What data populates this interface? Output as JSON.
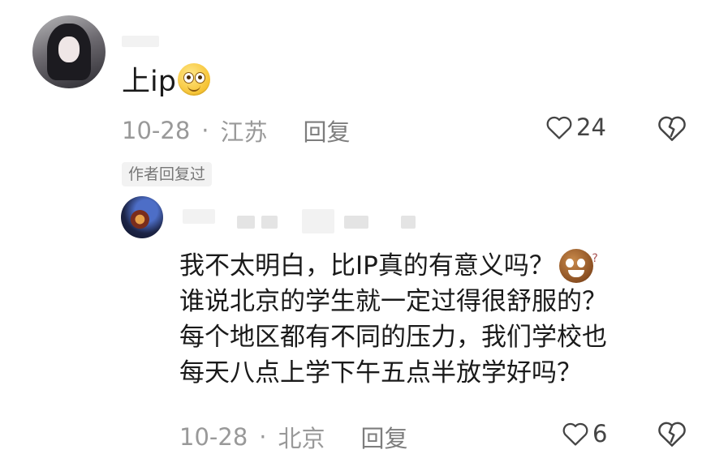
{
  "comment": {
    "text": "上ip",
    "emoji": "smiling-face-emoji",
    "date": "10-28",
    "location": "江苏",
    "reply_label": "回复",
    "likes": "24",
    "badge": "作者回复过"
  },
  "reply": {
    "lines": [
      "我不太明白，比IP真的有意义吗？",
      "谁说北京的学生就一定过得很舒服的？",
      "每个地区都有不同的压力，我们学校也",
      "每天八点上学下午五点半放学好吗？"
    ],
    "emoji": "cookie-face-emoji",
    "date": "10-28",
    "location": "北京",
    "reply_label": "回复",
    "likes": "6"
  },
  "icons": {
    "like": "heart-outline-icon",
    "dislike": "broken-heart-icon"
  },
  "colors": {
    "meta": "#999999",
    "text": "#1a1a1a",
    "badge_bg": "#f2f2f2"
  }
}
